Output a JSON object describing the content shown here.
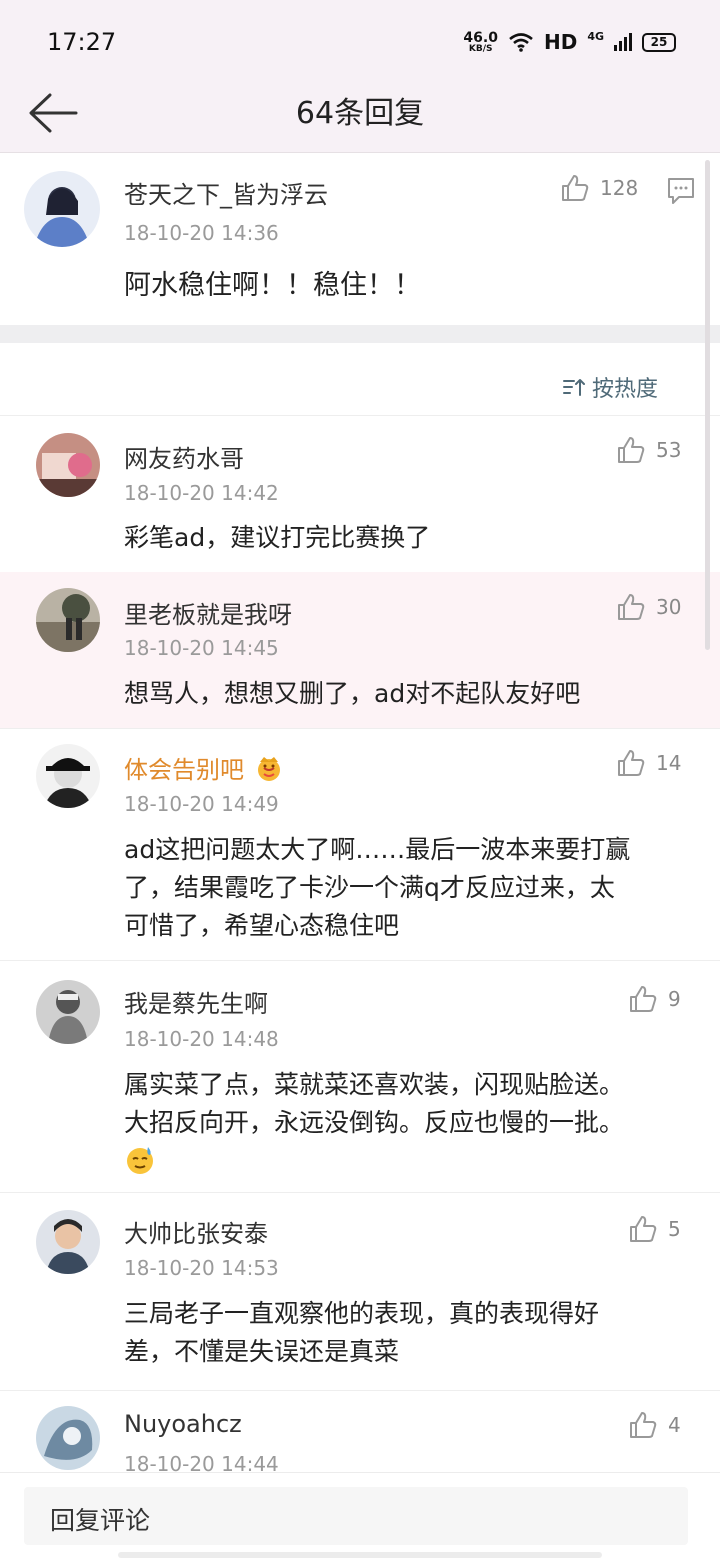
{
  "status_bar": {
    "time": "17:27",
    "net_speed_value": "46.0",
    "net_speed_unit": "KB/S",
    "hd": "HD",
    "network": "4G",
    "battery": "25"
  },
  "header": {
    "title": "64条回复",
    "back_icon": "back-arrow-icon"
  },
  "main_comment": {
    "user": "苍天之下_皆为浮云",
    "date": "18-10-20 14:36",
    "likes": "128",
    "text": "阿水稳住啊！！稳住！！"
  },
  "sort": {
    "label": "按热度",
    "icon": "sort-icon"
  },
  "replies": [
    {
      "user": "网友药水哥",
      "date": "18-10-20 14:42",
      "likes": "53",
      "lines": [
        "彩笔ad，建议打完比赛换了"
      ]
    },
    {
      "user": "里老板就是我呀",
      "date": "18-10-20 14:45",
      "likes": "30",
      "lines": [
        "想骂人，想想又删了，ad对不起队友好吧"
      ]
    },
    {
      "user": "体会告别吧",
      "date": "18-10-20 14:49",
      "likes": "14",
      "lines": [
        "ad这把问题太大了啊……最后一波本来要打赢",
        "了，结果霞吃了卡沙一个满q才反应过来，太",
        "可惜了，希望心态稳住吧"
      ]
    },
    {
      "user": "我是蔡先生啊",
      "date": "18-10-20 14:48",
      "likes": "9",
      "lines": [
        "属实菜了点，菜就菜还喜欢装，闪现贴脸送。",
        "大招反向开，永远没倒钩。反应也慢的一批。"
      ]
    },
    {
      "user": "大帅比张安泰",
      "date": "18-10-20 14:53",
      "likes": "5",
      "lines": [
        "三局老子一直观察他的表现，真的表现得好",
        "差，不懂是失误还是真菜"
      ]
    },
    {
      "user": "Nuyoahcz",
      "date": "18-10-20 14:44",
      "likes": "4",
      "lines": []
    }
  ],
  "bottom": {
    "placeholder": "回复评论"
  },
  "colors": {
    "header_bg": "#f7f1f6",
    "vip_name": "#e08a2c",
    "sort_text": "#4f6a78"
  }
}
